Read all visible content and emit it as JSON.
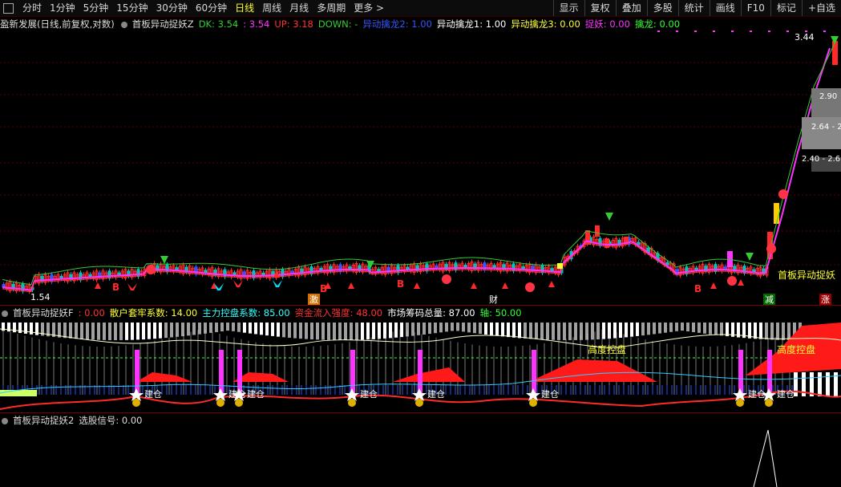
{
  "toolbar": {
    "periods": [
      "分时",
      "1分钟",
      "5分钟",
      "15分钟",
      "30分钟",
      "60分钟",
      "日线",
      "周线",
      "月线",
      "多周期",
      "更多 >"
    ],
    "active_period": "日线",
    "right_buttons": [
      "显示",
      "复权",
      "叠加",
      "多股",
      "统计",
      "画线",
      "F10",
      "标记",
      "+自选"
    ]
  },
  "main_panel": {
    "stock_title": "盈新发展(日线,前复权,对数)",
    "indicator_name": "首板异动捉妖Z",
    "values": [
      {
        "label": "DK: 3.54",
        "color": "#33cc33"
      },
      {
        "label": ": 3.54",
        "color": "#ff33ff"
      },
      {
        "label": "UP: 3.18",
        "color": "#ff3333"
      },
      {
        "label": "DOWN: -",
        "color": "#33cc33"
      },
      {
        "label": "异动擒龙2: 1.00",
        "color": "#3355ff"
      },
      {
        "label": "异动擒龙1: 1.00",
        "color": "#ffffff"
      },
      {
        "label": "异动擒龙3: 0.00",
        "color": "#ffff33"
      },
      {
        "label": "捉妖: 0.00",
        "color": "#ff33ff"
      },
      {
        "label": "擒龙: 0.00",
        "color": "#33ff33"
      }
    ],
    "price_high": "3.44",
    "price_low": "1.54",
    "price_levels": [
      "2.90",
      "2.64 - 2.",
      "2.40 - 2.6"
    ],
    "signal_text": "首板异动捉妖",
    "marker_jian": "减",
    "marker_zhang": "涨",
    "marker_ji": "激",
    "marker_cai": "财",
    "marker_b": "B",
    "marker_b2": "B",
    "marker_b3": "B",
    "marker_b4": "B"
  },
  "panel2": {
    "indicator_name": "首板异动捉妖F",
    "values": [
      {
        "label": ": 0.00",
        "color": "#ff3333"
      },
      {
        "label": "散户套牢系数: 14.00",
        "color": "#ffff33"
      },
      {
        "label": "主力控盘系数: 85.00",
        "color": "#33ffff"
      },
      {
        "label": "资金流入强度: 48.00",
        "color": "#ff3333"
      },
      {
        "label": "市场筹码总量: 87.00",
        "color": "#ffffff"
      },
      {
        "label": "轴: 50.00",
        "color": "#33ff33"
      }
    ],
    "label_gaodu_1": "高度控盘",
    "label_gaodu_2": "高度控盘",
    "build_label": "建仓"
  },
  "panel3": {
    "indicator_name": "首板异动捉妖2",
    "signal_label": "选股信号: 0.00"
  },
  "colors": {
    "up": "#ff2a2a",
    "down": "#00c0c0",
    "dk_line": "#ff33ff",
    "up_line": "#ff3333",
    "down_line": "#33cc33",
    "grid": "#5a0000"
  }
}
